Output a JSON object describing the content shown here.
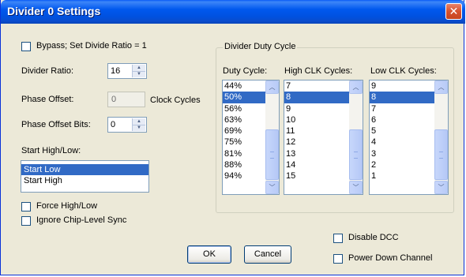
{
  "window": {
    "title": "Divider 0 Settings",
    "close_glyph": "✕"
  },
  "bypass": {
    "label": "Bypass; Set Divide Ratio = 1",
    "checked": false
  },
  "divider_ratio": {
    "label": "Divider Ratio:",
    "value": "16"
  },
  "phase_offset": {
    "label": "Phase Offset:",
    "value": "0",
    "unit": "Clock Cycles"
  },
  "phase_offset_bits": {
    "label": "Phase Offset Bits:",
    "value": "0"
  },
  "start_high_low": {
    "label": "Start High/Low:",
    "options": [
      "Start Low",
      "Start High"
    ],
    "selected": "Start Low"
  },
  "force_high_low": {
    "label": "Force High/Low",
    "checked": false
  },
  "ignore_sync": {
    "label": "Ignore Chip-Level Sync",
    "checked": false
  },
  "duty_group": {
    "title": "Divider Duty Cycle",
    "duty_cycle": {
      "header": "Duty Cycle:",
      "items": [
        "44%",
        "50%",
        "56%",
        "63%",
        "69%",
        "75%",
        "81%",
        "88%",
        "94%"
      ],
      "selected": "50%"
    },
    "high_clk": {
      "header": "High CLK Cycles:",
      "items": [
        "7",
        "8",
        "9",
        "10",
        "11",
        "12",
        "13",
        "14",
        "15"
      ],
      "selected": "8"
    },
    "low_clk": {
      "header": "Low CLK Cycles:",
      "items": [
        "9",
        "8",
        "7",
        "6",
        "5",
        "4",
        "3",
        "2",
        "1"
      ],
      "selected": "8"
    }
  },
  "disable_dcc": {
    "label": "Disable DCC",
    "checked": false
  },
  "power_down": {
    "label": "Power Down Channel",
    "checked": false
  },
  "buttons": {
    "ok": "OK",
    "cancel": "Cancel"
  },
  "icons": {
    "spin_up": "▲",
    "spin_down": "▼",
    "scroll_up": "︿",
    "scroll_down": "﹀"
  },
  "colors": {
    "selection": "#316ac5",
    "titlebar": "#0058ee",
    "close": "#d6522e"
  }
}
